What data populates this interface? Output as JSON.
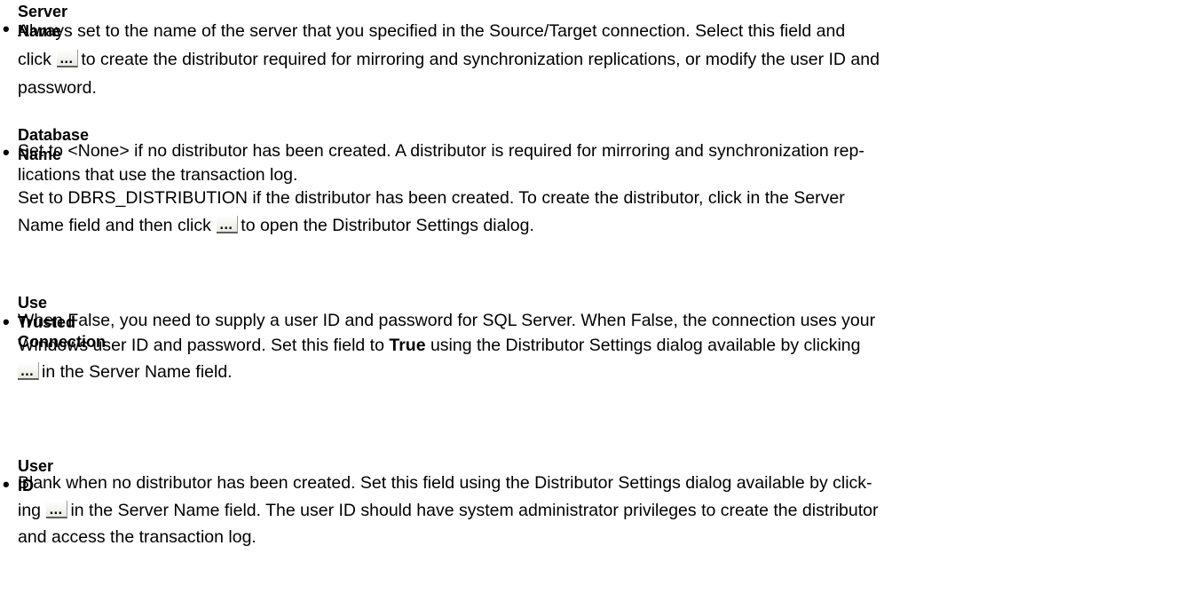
{
  "entries": [
    {
      "term": "Server Name",
      "line1": " Always set to the name of the server that you specified in the Source/Target connection. Select this field and",
      "line2_pre": "click ",
      "line2_post": "to create the distributor required for mirroring and synchronization replications, or modify the user ID and",
      "line3": "password."
    },
    {
      "term": "Database Name",
      "line1": " Set to <None> if no distributor has been created. A distributor is required for mirroring and synchronization rep-",
      "line2": "lications that use the transaction log.",
      "line3": " Set to DBRS_DISTRIBUTION if the distributor has been created. To create the distributor, click in the Server",
      "line4_pre": "Name field and then click ",
      "line4_post": "to open the Distributor Settings dialog."
    },
    {
      "term": "Use Trusted Connection",
      "line1": " When False, you need to supply a user ID and password for SQL Server. When False, the connection uses your",
      "line2_pre": "Windows user ID and password. Set this field to ",
      "line2_bold": "True",
      "line2_post": " using the  Distributor Settings dialog available by clicking",
      "line3_post": "in the Server Name field."
    },
    {
      "term": "User ID",
      "line1": " Blank when no distributor has been created. Set this field using the Distributor Settings dialog available by click-",
      "line2_pre": "ing ",
      "line2_post": "in the Server Name field. The user ID should have system administrator privileges to create the distributor",
      "line3": "and access the transaction log."
    }
  ],
  "bullet_glyph": "•",
  "ellipsis_button_icon": "ellipsis-button-icon"
}
